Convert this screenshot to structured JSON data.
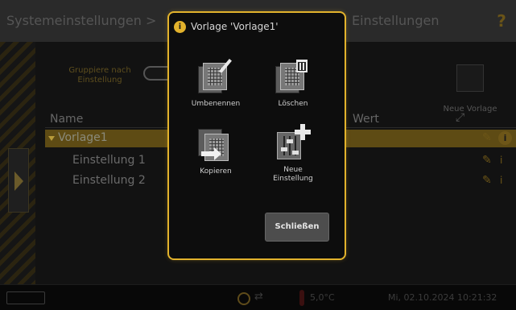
{
  "header": {
    "title_left": "Systemeinstellungen >",
    "title_right": "Einstellungen",
    "help_label": "?"
  },
  "toolbar": {
    "group_label": "Gruppiere nach Einstellung",
    "new_template_label": "Neue Vorlage"
  },
  "table": {
    "columns": [
      "Name",
      "Wert"
    ],
    "rows": [
      {
        "name": "Vorlage1",
        "selected": true
      },
      {
        "name": "Einstellung 1"
      },
      {
        "name": "Einstellung 2"
      }
    ]
  },
  "dialog": {
    "title": "Vorlage 'Vorlage1'",
    "actions": [
      {
        "label": "Umbenennen",
        "icon": "rename-icon"
      },
      {
        "label": "Löschen",
        "icon": "delete-icon"
      },
      {
        "label": "Kopieren",
        "icon": "copy-icon"
      },
      {
        "label": "Neue Einstellung",
        "icon": "new-setting-icon"
      }
    ],
    "close_label": "Schließen"
  },
  "status": {
    "temperature": "5,0°C",
    "datetime": "Mi, 02.10.2024 10:21:32"
  },
  "colors": {
    "accent": "#e2b22c",
    "selected_row": "#5e4b14"
  }
}
